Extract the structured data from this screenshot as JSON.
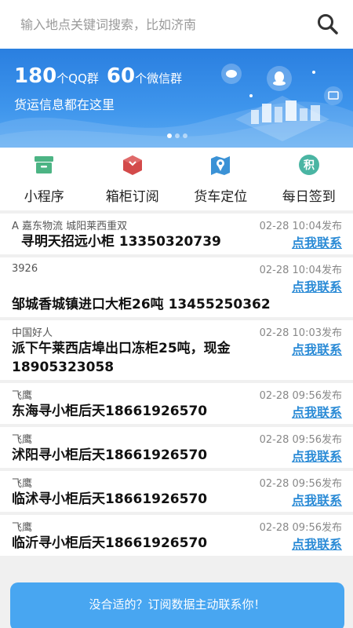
{
  "search": {
    "placeholder": "输入地点关键词搜索，比如济南"
  },
  "banner": {
    "qq_count": "180",
    "qq_unit": "个QQ群",
    "wechat_count": "60",
    "wechat_unit": "个微信群",
    "subtitle": "货运信息都在这里"
  },
  "nav": [
    {
      "label": "小程序",
      "icon": "package-icon",
      "color": "#4cb484"
    },
    {
      "label": "箱柜订阅",
      "icon": "gift-box-icon",
      "color": "#d34a4a"
    },
    {
      "label": "货车定位",
      "icon": "map-pin-icon",
      "color": "#3b92d6"
    },
    {
      "label": "每日签到",
      "icon": "points-icon",
      "color": "#4ab5a3",
      "glyph": "积"
    }
  ],
  "feed": [
    {
      "source": "A 嘉东物流 城阳莱西重双",
      "time": "02-28 10:04发布",
      "text": "  寻明天招远小柜 13350320739",
      "contact": "点我联系"
    },
    {
      "source": "3926",
      "time": "02-28 10:04发布",
      "text": "邹城香城镇进口大柜26吨 13455250362",
      "contact": "点我联系"
    },
    {
      "source": "中国好人",
      "time": "02-28 10:03发布",
      "text": "派下午莱西店埠出口冻柜25吨，现金18905323058",
      "contact": "点我联系"
    },
    {
      "source": "飞鹰",
      "time": "02-28 09:56发布",
      "text": "东海寻小柜后天18661926570",
      "contact": "点我联系"
    },
    {
      "source": "飞鹰",
      "time": "02-28 09:56发布",
      "text": "沭阳寻小柜后天18661926570",
      "contact": "点我联系"
    },
    {
      "source": "飞鹰",
      "time": "02-28 09:56发布",
      "text": "临沭寻小柜后天18661926570",
      "contact": "点我联系"
    },
    {
      "source": "飞鹰",
      "time": "02-28 09:56发布",
      "text": "临沂寻小柜后天18661926570",
      "contact": "点我联系"
    }
  ],
  "cta": {
    "label": "没合适的？订阅数据主动联系你！"
  }
}
